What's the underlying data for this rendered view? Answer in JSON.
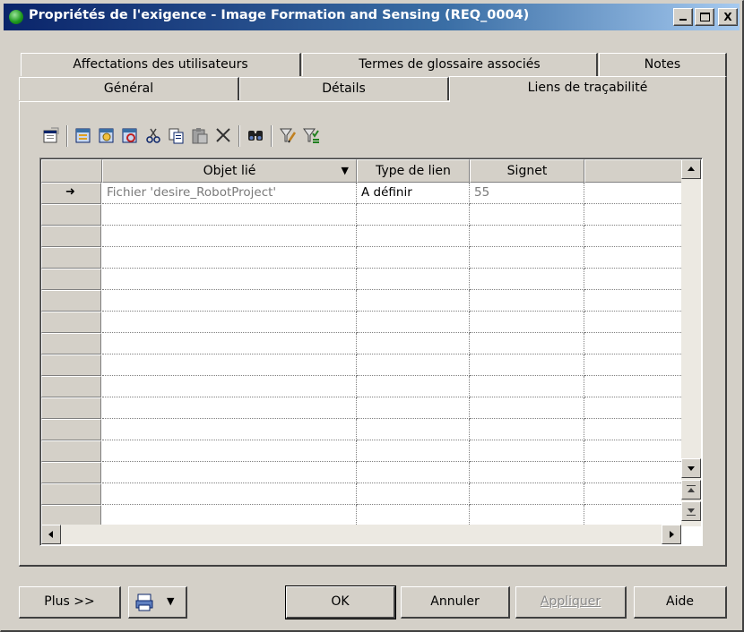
{
  "window": {
    "title": "Propriétés de l'exigence - Image Formation and Sensing (REQ_0004)",
    "minimize": "",
    "maximize": "",
    "close": "X"
  },
  "tabs": {
    "row1": [
      "Affectations des utilisateurs",
      "Termes de glossaire associés",
      "Notes"
    ],
    "row2": [
      "Général",
      "Détails",
      "Liens de traçabilité"
    ],
    "active": "Liens de traçabilité"
  },
  "toolbar": {
    "icons": [
      "properties-icon",
      "add-objects-icon",
      "add-link-icon",
      "create-link-icon",
      "cut-icon",
      "copy-icon",
      "paste-icon",
      "delete-icon",
      "find-icon",
      "filter-icon",
      "clear-filter-icon"
    ]
  },
  "grid": {
    "columns": [
      "Objet lié",
      "Type de lien",
      "Signet"
    ],
    "rows": [
      {
        "object": "Fichier 'desire_RobotProject'",
        "type": "A définir",
        "bookmark": "55",
        "current": true
      }
    ],
    "empty_rows": 15
  },
  "buttons": {
    "more": "Plus >>",
    "ok": "OK",
    "cancel": "Annuler",
    "apply": "Appliquer",
    "help": "Aide"
  },
  "colors": {
    "titlebar_start": "#0a246a",
    "titlebar_end": "#a6caf0",
    "face": "#d4d0c8"
  }
}
